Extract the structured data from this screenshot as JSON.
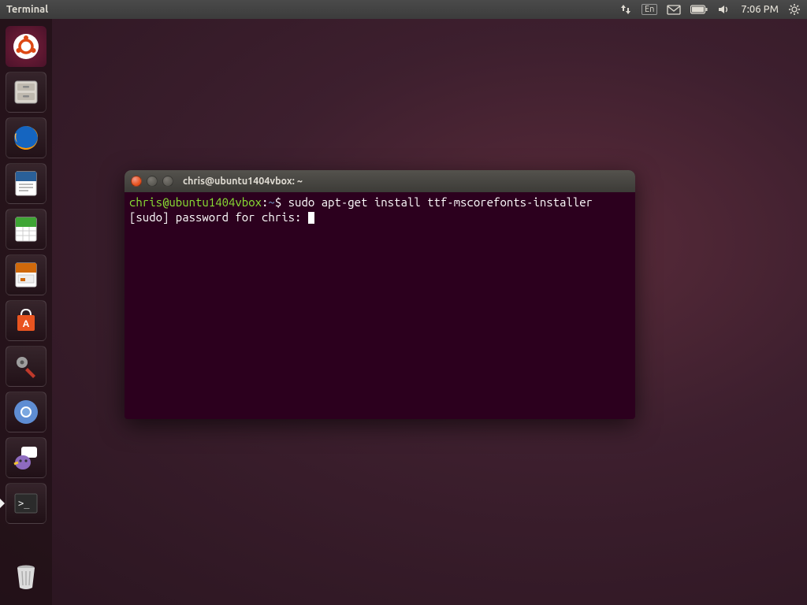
{
  "top_panel": {
    "app_name": "Terminal",
    "language_indicator": "En",
    "time": "7:06 PM"
  },
  "launcher": {
    "items": [
      {
        "key": "dash",
        "title": "Dash"
      },
      {
        "key": "files",
        "title": "Files"
      },
      {
        "key": "firefox",
        "title": "Firefox"
      },
      {
        "key": "writer",
        "title": "LibreOffice Writer"
      },
      {
        "key": "calc",
        "title": "LibreOffice Calc"
      },
      {
        "key": "impress",
        "title": "LibreOffice Impress"
      },
      {
        "key": "software",
        "title": "Ubuntu Software Center"
      },
      {
        "key": "settings",
        "title": "System Settings"
      },
      {
        "key": "chromium",
        "title": "Chromium"
      },
      {
        "key": "pidgin",
        "title": "Pidgin"
      },
      {
        "key": "terminal",
        "title": "Terminal"
      }
    ],
    "trash": "Trash"
  },
  "terminal": {
    "title": "chris@ubuntu1404vbox: ~",
    "prompt_userhost": "chris@ubuntu1404vbox",
    "prompt_path": "~",
    "prompt_suffix": "$",
    "command": "sudo apt-get install ttf-mscorefonts-installer",
    "line2": "[sudo] password for chris: "
  }
}
